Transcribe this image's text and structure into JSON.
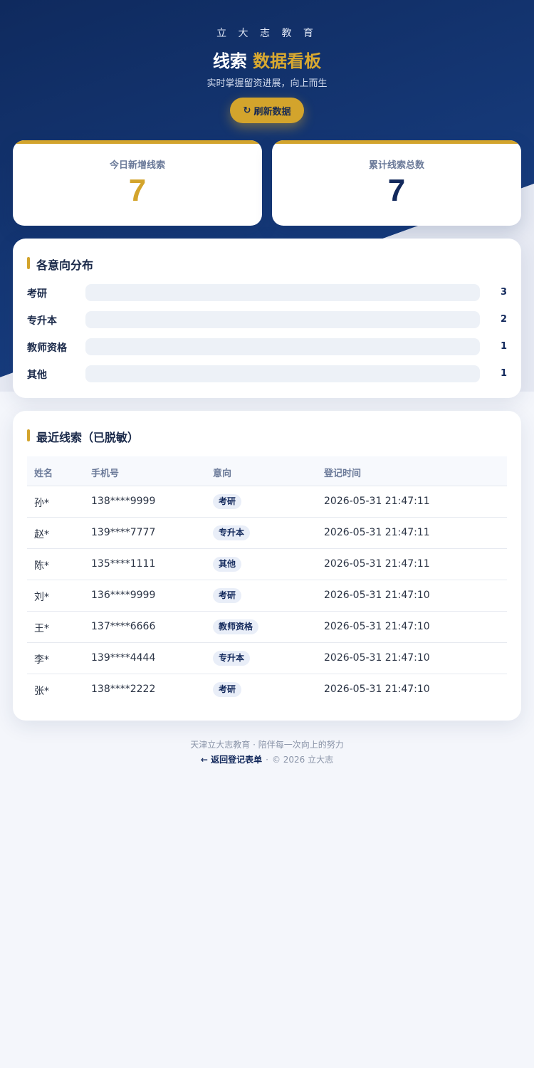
{
  "header": {
    "brand": "立 大 志 教 育",
    "title_main": "线索",
    "title_accent": "数据看板",
    "subtitle": "实时掌握留资进展，向上而生",
    "refresh_icon": "↻",
    "refresh_label": "刷新数据"
  },
  "stats": {
    "today_label": "今日新增线索",
    "today_value": "7",
    "total_label": "累计线索总数",
    "total_value": "7"
  },
  "distribution": {
    "title": "各意向分布",
    "items": [
      {
        "label": "考研",
        "count": "3"
      },
      {
        "label": "专升本",
        "count": "2"
      },
      {
        "label": "教师资格",
        "count": "1"
      },
      {
        "label": "其他",
        "count": "1"
      }
    ]
  },
  "recent": {
    "title": "最近线索（已脱敏）",
    "columns": [
      "姓名",
      "手机号",
      "意向",
      "登记时间"
    ],
    "rows": [
      {
        "name": "孙*",
        "phone": "138****9999",
        "intent": "考研",
        "time": "2026-05-31 21:47:11"
      },
      {
        "name": "赵*",
        "phone": "139****7777",
        "intent": "专升本",
        "time": "2026-05-31 21:47:11"
      },
      {
        "name": "陈*",
        "phone": "135****1111",
        "intent": "其他",
        "time": "2026-05-31 21:47:11"
      },
      {
        "name": "刘*",
        "phone": "136****9999",
        "intent": "考研",
        "time": "2026-05-31 21:47:10"
      },
      {
        "name": "王*",
        "phone": "137****6666",
        "intent": "教师资格",
        "time": "2026-05-31 21:47:10"
      },
      {
        "name": "李*",
        "phone": "139****4444",
        "intent": "专升本",
        "time": "2026-05-31 21:47:10"
      },
      {
        "name": "张*",
        "phone": "138****2222",
        "intent": "考研",
        "time": "2026-05-31 21:47:10"
      }
    ]
  },
  "footer": {
    "tagline": "天津立大志教育 · 陪伴每一次向上的努力",
    "back_link": "← 返回登记表单",
    "separator": "·",
    "copyright": "© 2026 立大志"
  },
  "colors": {
    "navy": "#13295c",
    "gold": "#d3a42c",
    "background": "#f4f6fb"
  }
}
